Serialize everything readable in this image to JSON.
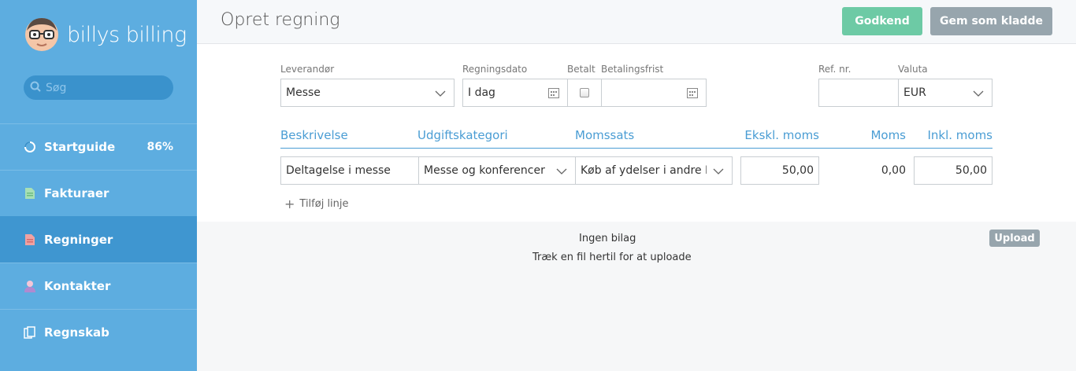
{
  "brand": {
    "name": "billys billing",
    "logo_icon": "glasses-face-logo"
  },
  "search": {
    "placeholder": "Søg"
  },
  "nav": [
    {
      "label": "Startguide",
      "icon": "progress-ring-icon",
      "percent": "86%"
    },
    {
      "label": "Fakturaer",
      "icon": "invoice-icon"
    },
    {
      "label": "Regninger",
      "icon": "bill-icon",
      "active": true
    },
    {
      "label": "Kontakter",
      "icon": "person-icon"
    },
    {
      "label": "Regnskab",
      "icon": "ledger-icon"
    }
  ],
  "header": {
    "title": "Opret regning",
    "approve_label": "Godkend",
    "draft_label": "Gem som kladde"
  },
  "form": {
    "vendor_label": "Leverandør",
    "vendor_value": "Messe",
    "date_label": "Regningsdato",
    "date_value": "I dag",
    "paid_label": "Betalt",
    "due_label": "Betalingsfrist",
    "due_value": "",
    "ref_label": "Ref. nr.",
    "ref_value": "",
    "currency_label": "Valuta",
    "currency_value": "EUR"
  },
  "lines": {
    "headers": {
      "description": "Beskrivelse",
      "category": "Udgiftskategori",
      "vat_rate": "Momssats",
      "excl": "Ekskl. moms",
      "vat": "Moms",
      "incl": "Inkl. moms"
    },
    "rows": [
      {
        "description": "Deltagelse i messe",
        "category": "Messe og konferencer",
        "vat_rate": "Køb af ydelser i andre E",
        "excl": "50,00",
        "vat": "0,00",
        "incl": "50,00"
      }
    ],
    "add_label": "Tilføj linje"
  },
  "attachments": {
    "empty_text": "Ingen bilag",
    "drop_text": "Træk en fil hertil for at uploade",
    "upload_label": "Upload"
  },
  "colors": {
    "sidebar": "#5dade0",
    "sidebar_active": "#3f96d0",
    "approve": "#6dcaa5",
    "secondary": "#97a5ad",
    "accent": "#4a9dd4"
  }
}
